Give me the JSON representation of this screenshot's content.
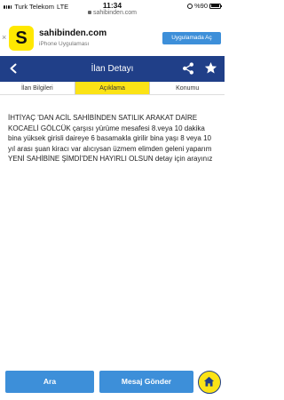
{
  "status_bar": {
    "carrier": "Turk Telekom",
    "network": "LTE",
    "time": "11:34",
    "url": "sahibinden.com",
    "battery": "%90"
  },
  "app_banner": {
    "close": "×",
    "logo_letter": "S",
    "title": "sahibinden.com",
    "subtitle": "iPhone Uygulaması",
    "cta_label": "Uygulamada Aç"
  },
  "header": {
    "title": "İlan Detayı"
  },
  "tabs": [
    {
      "label": "İlan Bilgileri",
      "active": false
    },
    {
      "label": "Açıklama",
      "active": true
    },
    {
      "label": "Konumu",
      "active": false
    }
  ],
  "description": "İHTİYAÇ 'DAN ACİL SAHİBİNDEN SATILIK ARAKAT DAİRE KOCAELİ GÖLCÜK çarşısı yürüme mesafesi 8.veya 10 dakika bina yüksek girisli daireye 6 basamakla girilir bina yaşı 8 veya 10 yıl arası şuan kiracı var alıcıysan üzmem elimden geleni yaparım YENİ SAHİBİNE ŞİMDİ'DEN HAYIRLI OLSUN detay için arayınız",
  "bottom_bar": {
    "search_label": "Ara",
    "message_label": "Mesaj Gönder"
  },
  "colors": {
    "header_bg": "#203f88",
    "accent_yellow": "#fbe316",
    "button_blue": "#3d8fd9"
  }
}
